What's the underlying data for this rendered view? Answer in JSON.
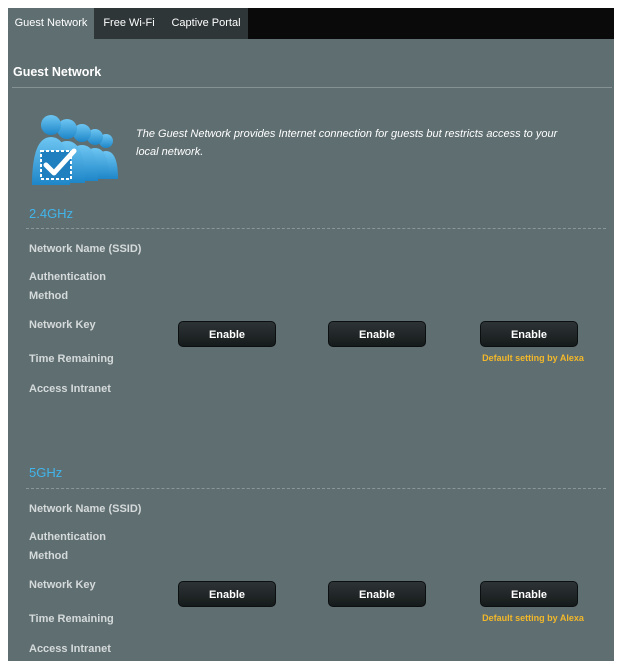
{
  "tabs": [
    {
      "label": "Guest Network",
      "active": true
    },
    {
      "label": "Free Wi-Fi",
      "active": false
    },
    {
      "label": "Captive Portal",
      "active": false
    }
  ],
  "page_title": "Guest Network",
  "intro_text": "The Guest Network provides Internet connection for guests but restricts access to your local network.",
  "icon": "guest-users-checkmark-icon",
  "bands": [
    {
      "title": "2.4GHz",
      "rows": {
        "ssid": "Network Name (SSID)",
        "auth_line1": "Authentication",
        "auth_line2": "Method",
        "key": "Network Key",
        "time": "Time Remaining",
        "intranet": "Access Intranet"
      },
      "buttons": [
        "Enable",
        "Enable",
        "Enable"
      ],
      "alexa_note": "Default setting by Alexa"
    },
    {
      "title": "5GHz",
      "rows": {
        "ssid": "Network Name (SSID)",
        "auth_line1": "Authentication",
        "auth_line2": "Method",
        "key": "Network Key",
        "time": "Time Remaining",
        "intranet": "Access Intranet"
      },
      "buttons": [
        "Enable",
        "Enable",
        "Enable"
      ],
      "alexa_note": "Default setting by Alexa"
    }
  ],
  "colors": {
    "panel_bg": "#5f6e71",
    "tabbar_bg": "#0a0a0a",
    "band_title": "#41b5ea",
    "alexa_note": "#f2b82a",
    "label_text": "#d5dadb"
  }
}
